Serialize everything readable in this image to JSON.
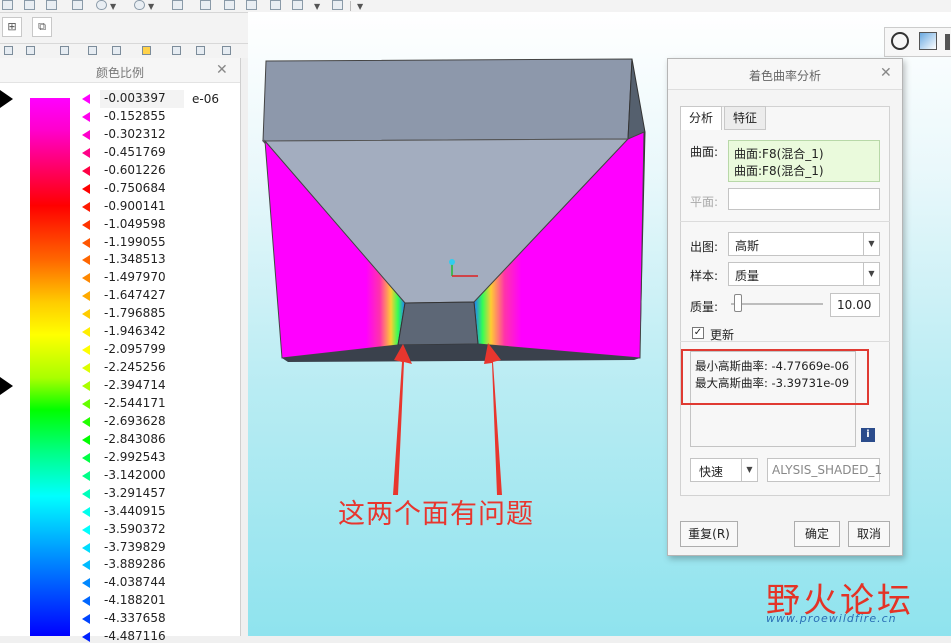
{
  "toolbar": {
    "icons": [
      "folder-icon",
      "save-icon",
      "undo-icon",
      "redo-icon",
      "regenerate-icon",
      "window-icon",
      "edit-icon",
      "settings-icon",
      "layers-icon",
      "view-icon",
      "close-window-icon"
    ]
  },
  "left_tabs": {
    "model_tree_icon": "model-tree-icon",
    "layer_icon": "layer-icon"
  },
  "color_scale": {
    "title": "颜色比例",
    "unit": "e-06",
    "values": [
      "-0.003397",
      "-0.152855",
      "-0.302312",
      "-0.451769",
      "-0.601226",
      "-0.750684",
      "-0.900141",
      "-1.049598",
      "-1.199055",
      "-1.348513",
      "-1.497970",
      "-1.647427",
      "-1.796885",
      "-1.946342",
      "-2.095799",
      "-2.245256",
      "-2.394714",
      "-2.544171",
      "-2.693628",
      "-2.843086",
      "-2.992543",
      "-3.142000",
      "-3.291457",
      "-3.440915",
      "-3.590372",
      "-3.739829",
      "-3.889286",
      "-4.038744",
      "-4.188201",
      "-4.337658",
      "-4.487116"
    ],
    "tick_colors": [
      "#ff00ff",
      "#ff00ee",
      "#ff00cc",
      "#ff0088",
      "#ff0044",
      "#ff0000",
      "#ff1a00",
      "#ff3300",
      "#ff5500",
      "#ff6600",
      "#ff8800",
      "#ffaa00",
      "#ffcc00",
      "#ffee00",
      "#ffff00",
      "#ddff00",
      "#aaff00",
      "#66ff00",
      "#22ff00",
      "#00ff00",
      "#00ff44",
      "#00ff88",
      "#00ffbb",
      "#00ffee",
      "#00ffff",
      "#00ddff",
      "#00bbff",
      "#0088ff",
      "#0066ff",
      "#0044ff",
      "#0022ff"
    ]
  },
  "dialog": {
    "title": "着色曲率分析",
    "tabs": [
      "分析",
      "特征"
    ],
    "surface_label": "曲面:",
    "surfaces": [
      "曲面:F8(混合_1)",
      "曲面:F8(混合_1)"
    ],
    "plane_label": "平面:",
    "output_label": "出图:",
    "output_value": "高斯",
    "sample_label": "样本:",
    "sample_value": "质量",
    "quality_label": "质量:",
    "quality_value": "10.00",
    "update_label": "更新",
    "update_checked": true,
    "result_min": "最小高斯曲率: -4.77669e-06",
    "result_max": "最大高斯曲率: -3.39731e-09",
    "info_icon": "i",
    "speed_value": "快速",
    "name_value": "ALYSIS_SHADED_1",
    "repeat_button": "重复(R)",
    "ok_button": "确定",
    "cancel_button": "取消"
  },
  "annotation": {
    "text": "这两个面有问题",
    "color": "#e8362e"
  },
  "watermark": {
    "name": "野火论坛",
    "url": "www.proewildfire.cn"
  }
}
